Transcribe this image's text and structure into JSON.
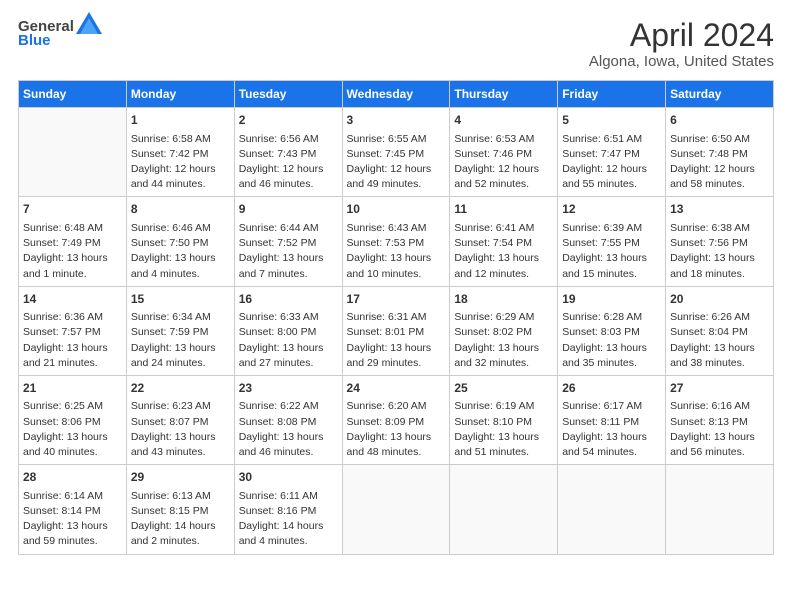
{
  "header": {
    "logo_line1": "General",
    "logo_line2": "Blue",
    "title": "April 2024",
    "subtitle": "Algona, Iowa, United States"
  },
  "days_of_week": [
    "Sunday",
    "Monday",
    "Tuesday",
    "Wednesday",
    "Thursday",
    "Friday",
    "Saturday"
  ],
  "weeks": [
    [
      {
        "day": "",
        "info": ""
      },
      {
        "day": "1",
        "info": "Sunrise: 6:58 AM\nSunset: 7:42 PM\nDaylight: 12 hours\nand 44 minutes."
      },
      {
        "day": "2",
        "info": "Sunrise: 6:56 AM\nSunset: 7:43 PM\nDaylight: 12 hours\nand 46 minutes."
      },
      {
        "day": "3",
        "info": "Sunrise: 6:55 AM\nSunset: 7:45 PM\nDaylight: 12 hours\nand 49 minutes."
      },
      {
        "day": "4",
        "info": "Sunrise: 6:53 AM\nSunset: 7:46 PM\nDaylight: 12 hours\nand 52 minutes."
      },
      {
        "day": "5",
        "info": "Sunrise: 6:51 AM\nSunset: 7:47 PM\nDaylight: 12 hours\nand 55 minutes."
      },
      {
        "day": "6",
        "info": "Sunrise: 6:50 AM\nSunset: 7:48 PM\nDaylight: 12 hours\nand 58 minutes."
      }
    ],
    [
      {
        "day": "7",
        "info": "Sunrise: 6:48 AM\nSunset: 7:49 PM\nDaylight: 13 hours\nand 1 minute."
      },
      {
        "day": "8",
        "info": "Sunrise: 6:46 AM\nSunset: 7:50 PM\nDaylight: 13 hours\nand 4 minutes."
      },
      {
        "day": "9",
        "info": "Sunrise: 6:44 AM\nSunset: 7:52 PM\nDaylight: 13 hours\nand 7 minutes."
      },
      {
        "day": "10",
        "info": "Sunrise: 6:43 AM\nSunset: 7:53 PM\nDaylight: 13 hours\nand 10 minutes."
      },
      {
        "day": "11",
        "info": "Sunrise: 6:41 AM\nSunset: 7:54 PM\nDaylight: 13 hours\nand 12 minutes."
      },
      {
        "day": "12",
        "info": "Sunrise: 6:39 AM\nSunset: 7:55 PM\nDaylight: 13 hours\nand 15 minutes."
      },
      {
        "day": "13",
        "info": "Sunrise: 6:38 AM\nSunset: 7:56 PM\nDaylight: 13 hours\nand 18 minutes."
      }
    ],
    [
      {
        "day": "14",
        "info": "Sunrise: 6:36 AM\nSunset: 7:57 PM\nDaylight: 13 hours\nand 21 minutes."
      },
      {
        "day": "15",
        "info": "Sunrise: 6:34 AM\nSunset: 7:59 PM\nDaylight: 13 hours\nand 24 minutes."
      },
      {
        "day": "16",
        "info": "Sunrise: 6:33 AM\nSunset: 8:00 PM\nDaylight: 13 hours\nand 27 minutes."
      },
      {
        "day": "17",
        "info": "Sunrise: 6:31 AM\nSunset: 8:01 PM\nDaylight: 13 hours\nand 29 minutes."
      },
      {
        "day": "18",
        "info": "Sunrise: 6:29 AM\nSunset: 8:02 PM\nDaylight: 13 hours\nand 32 minutes."
      },
      {
        "day": "19",
        "info": "Sunrise: 6:28 AM\nSunset: 8:03 PM\nDaylight: 13 hours\nand 35 minutes."
      },
      {
        "day": "20",
        "info": "Sunrise: 6:26 AM\nSunset: 8:04 PM\nDaylight: 13 hours\nand 38 minutes."
      }
    ],
    [
      {
        "day": "21",
        "info": "Sunrise: 6:25 AM\nSunset: 8:06 PM\nDaylight: 13 hours\nand 40 minutes."
      },
      {
        "day": "22",
        "info": "Sunrise: 6:23 AM\nSunset: 8:07 PM\nDaylight: 13 hours\nand 43 minutes."
      },
      {
        "day": "23",
        "info": "Sunrise: 6:22 AM\nSunset: 8:08 PM\nDaylight: 13 hours\nand 46 minutes."
      },
      {
        "day": "24",
        "info": "Sunrise: 6:20 AM\nSunset: 8:09 PM\nDaylight: 13 hours\nand 48 minutes."
      },
      {
        "day": "25",
        "info": "Sunrise: 6:19 AM\nSunset: 8:10 PM\nDaylight: 13 hours\nand 51 minutes."
      },
      {
        "day": "26",
        "info": "Sunrise: 6:17 AM\nSunset: 8:11 PM\nDaylight: 13 hours\nand 54 minutes."
      },
      {
        "day": "27",
        "info": "Sunrise: 6:16 AM\nSunset: 8:13 PM\nDaylight: 13 hours\nand 56 minutes."
      }
    ],
    [
      {
        "day": "28",
        "info": "Sunrise: 6:14 AM\nSunset: 8:14 PM\nDaylight: 13 hours\nand 59 minutes."
      },
      {
        "day": "29",
        "info": "Sunrise: 6:13 AM\nSunset: 8:15 PM\nDaylight: 14 hours\nand 2 minutes."
      },
      {
        "day": "30",
        "info": "Sunrise: 6:11 AM\nSunset: 8:16 PM\nDaylight: 14 hours\nand 4 minutes."
      },
      {
        "day": "",
        "info": ""
      },
      {
        "day": "",
        "info": ""
      },
      {
        "day": "",
        "info": ""
      },
      {
        "day": "",
        "info": ""
      }
    ]
  ]
}
